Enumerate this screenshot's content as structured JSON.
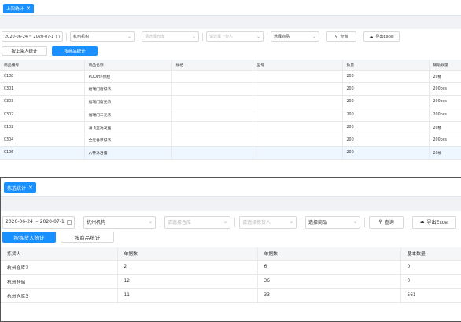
{
  "top": {
    "tab_label": "上架统计",
    "filters": {
      "date_range": "2020-06-24 ~ 2020-07-1",
      "org": "杭州机构",
      "warehouse_placeholder": "请选择仓库",
      "person_placeholder": "请选择上架人",
      "goods_placeholder": "选择商品",
      "search_label": "查询",
      "export_label": "导出Excel"
    },
    "toggles": [
      "按上架人统计",
      "按商品统计"
    ],
    "active_toggle": 1,
    "table": {
      "columns": [
        "商品编号",
        "商品名称",
        "规格",
        "型号",
        "数量",
        "辅助数量"
      ],
      "rows": [
        [
          "0108",
          "POOP环保膜",
          "",
          "",
          "200",
          "20桶"
        ],
        [
          "0301",
          "福瑞门窗好浓",
          "",
          "",
          "200",
          "200pcs"
        ],
        [
          "0303",
          "福瑞门窗光浓",
          "",
          "",
          "200",
          "200pcs"
        ],
        [
          "0302",
          "福瑞门三光浓",
          "",
          "",
          "200",
          "200pcs"
        ],
        [
          "0102",
          "海飞丝洗发露",
          "",
          "",
          "200",
          "20桶"
        ],
        [
          "0304",
          "全元香草好浓",
          "",
          "",
          "200",
          "200pcs"
        ],
        [
          "0106",
          "六神沐浴露",
          "",
          "",
          "200",
          "20桶"
        ]
      ],
      "highlight_row": 6
    }
  },
  "bottom": {
    "tab_label": "拣选统计",
    "filters": {
      "date_range": "2020-06-24 ~ 2020-07-1",
      "org": "杭州机构",
      "warehouse_placeholder": "请选择仓库",
      "person_placeholder": "请选择拣货人",
      "goods_placeholder": "选择商品",
      "search_label": "查询",
      "export_label": "导出Excel"
    },
    "toggles": [
      "按拣货人统计",
      "按商品统计"
    ],
    "active_toggle": 0,
    "table": {
      "columns": [
        "拣货人",
        "单据数",
        "单据数",
        "基本数量"
      ],
      "rows": [
        [
          "杭州仓库2",
          "2",
          "6",
          "0"
        ],
        [
          "杭州仓储",
          "12",
          "36",
          "0"
        ],
        [
          "杭州仓库3",
          "11",
          "33",
          "561"
        ]
      ]
    }
  },
  "icons": {
    "calendar": "calendar-icon",
    "search": "search-icon",
    "export": "cloud-download-icon",
    "close": "close-icon",
    "chevron": "chevron-down-icon"
  },
  "colors": {
    "primary": "#1890ff",
    "band": "#f0f2f5",
    "row_highlight": "#eef6ff"
  }
}
